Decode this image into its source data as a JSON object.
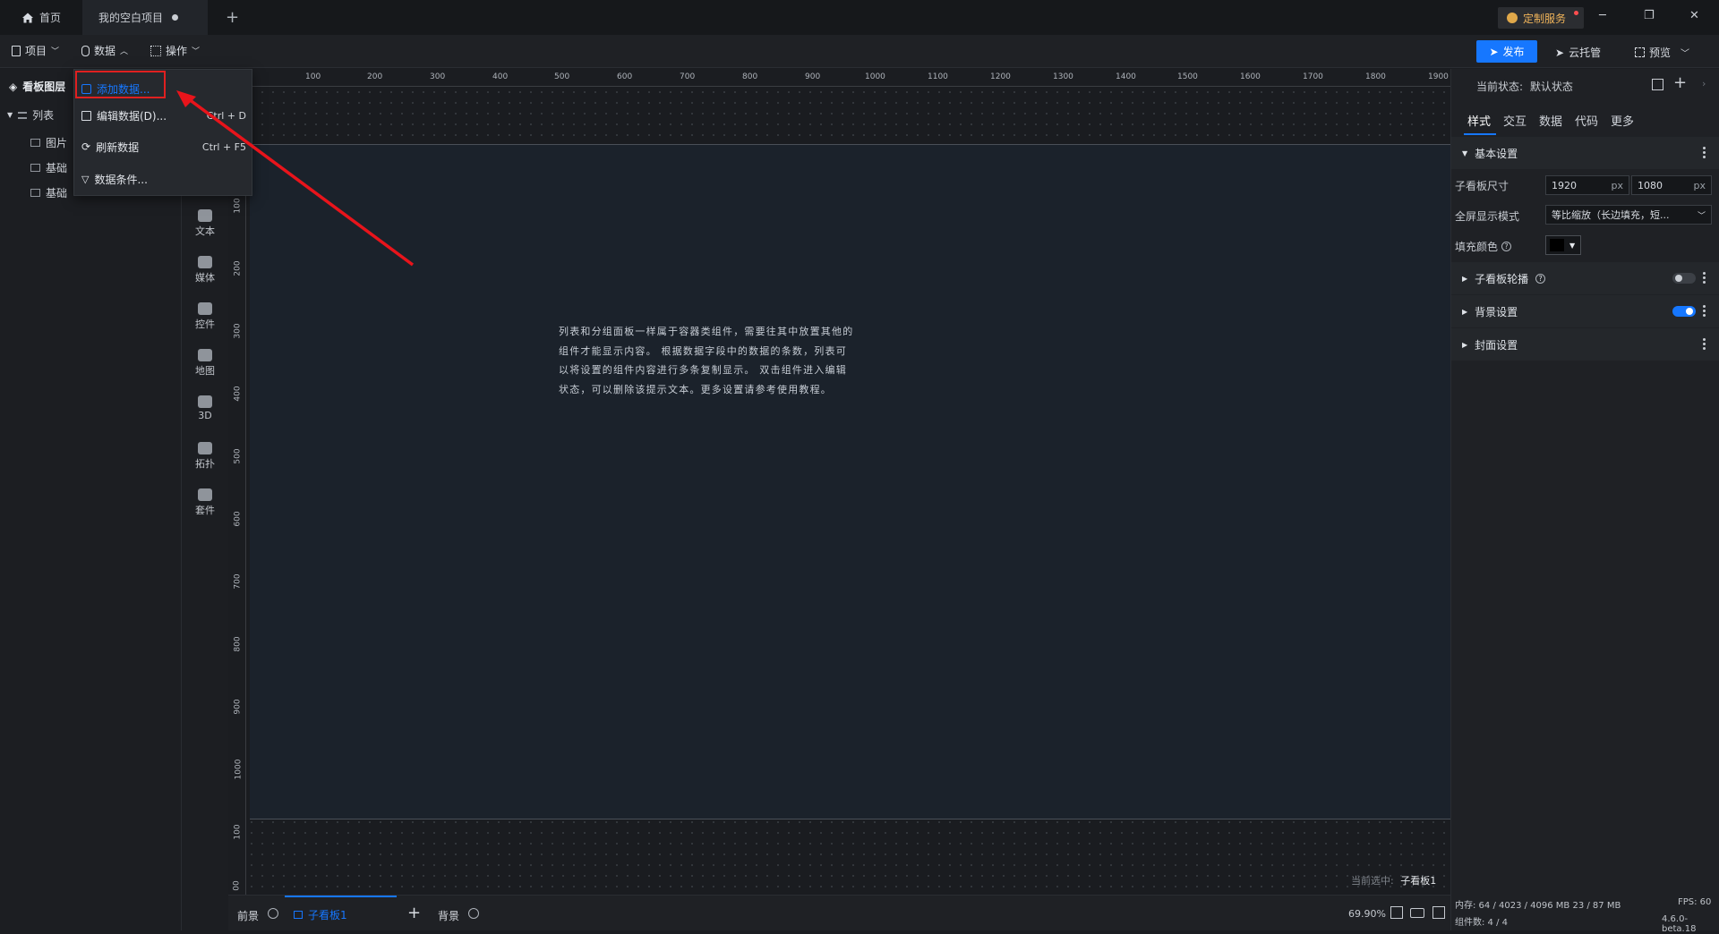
{
  "tabs": {
    "home": "首页",
    "project": "我的空白项目",
    "new_tab": "+"
  },
  "header": {
    "custom_service": "定制服务",
    "win_min": "─",
    "win_restore": "❐",
    "win_close": "✕"
  },
  "menu": {
    "project": "项目",
    "data": "数据",
    "ops": "操作"
  },
  "actions": {
    "publish": "发布",
    "cloud": "云托管",
    "preview": "预览"
  },
  "left": {
    "title": "看板图层",
    "layers": [
      "列表",
      "图片",
      "基础",
      "基础"
    ]
  },
  "components": [
    "文本",
    "媒体",
    "控件",
    "地图",
    "3D",
    "拓扑",
    "套件"
  ],
  "dropdown": {
    "items": [
      {
        "label": "添加数据...",
        "shortcut": ""
      },
      {
        "label": "编辑数据(D)...",
        "shortcut": "Ctrl + D"
      },
      {
        "label": "刷新数据",
        "shortcut": "Ctrl + F5"
      },
      {
        "label": "数据条件...",
        "shortcut": ""
      }
    ]
  },
  "ruler": {
    "top": [
      "100",
      "200",
      "300",
      "400",
      "500",
      "600",
      "700",
      "800",
      "900",
      "1000",
      "1100",
      "1200",
      "1300",
      "1400",
      "1500",
      "1600",
      "1700",
      "1800",
      "1900"
    ],
    "left": [
      "100",
      "200",
      "300",
      "400",
      "500",
      "600",
      "700",
      "800",
      "900",
      "1000",
      "100",
      "00"
    ]
  },
  "canvas": {
    "hint": "列表和分组面板一样属于容器类组件，需要往其中放置其他的组件才能显示内容。 根据数据字段中的数据的条数，列表可以将设置的组件内容进行多条复制显示。 双击组件进入编辑状态，可以删除该提示文本。更多设置请参考使用教程。",
    "current_selected_label": "当前选中:",
    "current_selected": "子看板1"
  },
  "bottom": {
    "front": "前景",
    "sub_board": "子看板1",
    "add": "+",
    "back": "背景",
    "zoom": "69.90%"
  },
  "right": {
    "state_label": "当前状态:",
    "state_value": "默认状态",
    "tabs": [
      "样式",
      "交互",
      "数据",
      "代码",
      "更多"
    ],
    "basic": "基本设置",
    "size_label": "子看板尺寸",
    "width": "1920",
    "height": "1080",
    "unit": "px",
    "fullscreen_label": "全屏显示模式",
    "fullscreen_value": "等比缩放（长边填充，短...",
    "fill_label": "填充颜色",
    "carousel": "子看板轮播",
    "background": "背景设置",
    "cover": "封面设置"
  },
  "status": {
    "memory": "内存:  64 / 4023 / 4096 MB  23 / 87 MB",
    "fps": "FPS:  60",
    "components": "组件数: 4 / 4",
    "version": "4.6.0-beta.18"
  },
  "colors": {
    "accent": "#1677ff",
    "highlight_box": "#e02020",
    "arrow": "#e8141b"
  }
}
